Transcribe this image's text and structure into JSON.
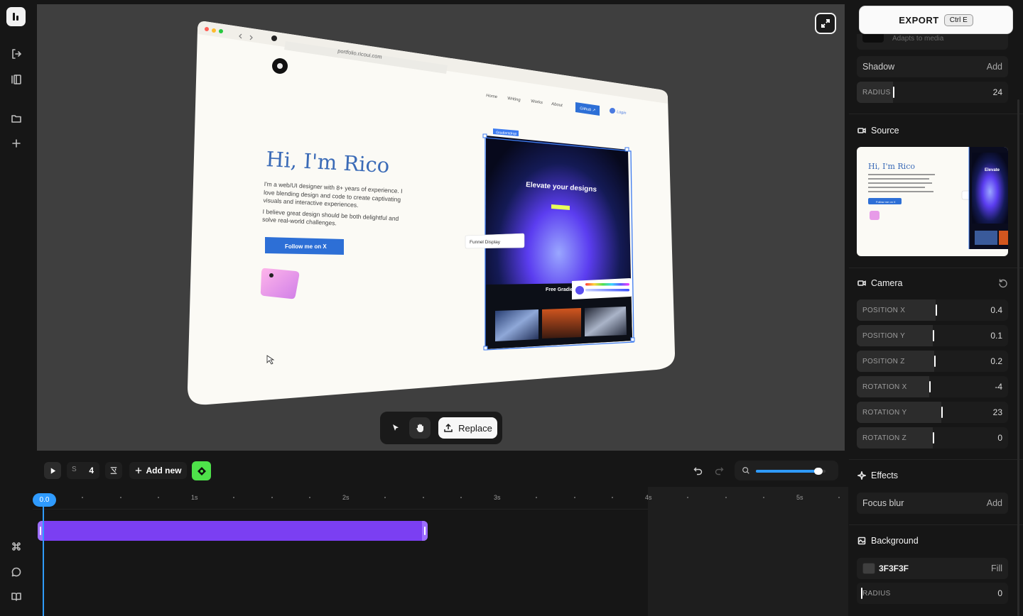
{
  "rail": {
    "top_icons": [
      "exit-icon",
      "panels-icon",
      "folder-icon",
      "plus-icon"
    ],
    "bottom_icons": [
      "command-icon",
      "chat-icon",
      "book-icon"
    ]
  },
  "mockup": {
    "url": "portfolio.ricoui.com",
    "nav": [
      "Home",
      "Writing",
      "Works",
      "About"
    ],
    "github_label": "Github ↗",
    "login_label": "Login",
    "heading": "Hi, I'm Rico",
    "intro": "I'm a web/UI designer with 8+ years of experience. I love blending design and code to create captivating visuals and interactive experiences.",
    "intro2": "I believe great design should be both delightful and solve real-world challenges.",
    "cta": "Follow me on X",
    "selection_tag": "Gradientdrop",
    "inner_heading": "Elevate your designs",
    "font_chip": "Funnel Display",
    "free_label": "Free Gradie"
  },
  "canvas_toolbar": {
    "replace_label": "Replace"
  },
  "timeline": {
    "length_prefix": "S",
    "length_value": "4",
    "add_new_label": "Add new",
    "playhead_label": "0.0",
    "ticks": [
      "1s",
      "2s",
      "3s",
      "4s",
      "5s"
    ],
    "zoom_fraction": 0.92
  },
  "panel": {
    "export_label": "EXPORT",
    "export_shortcut": "Ctrl E",
    "partial_text": "Adapts to media",
    "shadow": {
      "label": "Shadow",
      "action": "Add"
    },
    "frame_radius": {
      "label": "RADIUS",
      "value": "24",
      "fraction": 0.24
    },
    "source_title": "Source",
    "source_preview": {
      "heading": "Hi, I'm Rico",
      "cta": "Follow me on X",
      "side": "Elevate"
    },
    "camera_title": "Camera",
    "camera_rows": [
      {
        "label": "POSITION X",
        "value": "0.4",
        "fraction": 0.52
      },
      {
        "label": "POSITION Y",
        "value": "0.1",
        "fraction": 0.5
      },
      {
        "label": "POSITION Z",
        "value": "0.2",
        "fraction": 0.51
      },
      {
        "label": "ROTATION X",
        "value": "-4",
        "fraction": 0.48
      },
      {
        "label": "ROTATION Y",
        "value": "23",
        "fraction": 0.56
      },
      {
        "label": "ROTATION Z",
        "value": "0",
        "fraction": 0.5
      }
    ],
    "effects_title": "Effects",
    "focus_blur": {
      "label": "Focus blur",
      "action": "Add"
    },
    "background_title": "Background",
    "background": {
      "hex": "3F3F3F",
      "mode": "Fill",
      "color": "#3f3f3f"
    },
    "bg_radius": {
      "label": "RADIUS",
      "value": "0",
      "fraction": 0.0
    }
  },
  "colors": {
    "accent": "#2f9bff",
    "clip": "#7b3ff2",
    "green": "#4ee24a",
    "canvas": "#3f3f3f"
  }
}
